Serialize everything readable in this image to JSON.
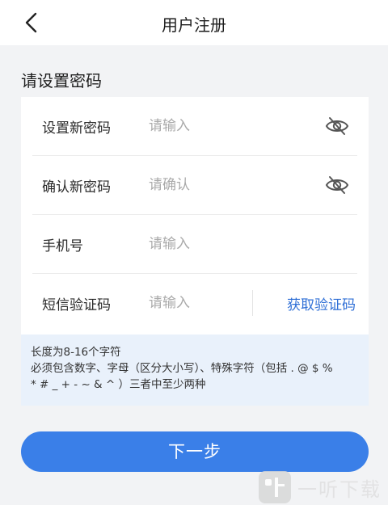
{
  "header": {
    "title": "用户注册",
    "back_icon": "chevron-left-icon"
  },
  "section_title": "请设置密码",
  "form": {
    "new_password": {
      "label": "设置新密码",
      "placeholder": "请输入",
      "icon": "eye-off-icon"
    },
    "confirm_password": {
      "label": "确认新密码",
      "placeholder": "请确认",
      "icon": "eye-off-icon"
    },
    "phone": {
      "label": "手机号",
      "placeholder": "请输入"
    },
    "sms_code": {
      "label": "短信验证码",
      "placeholder": "请输入",
      "button": "获取验证码"
    }
  },
  "hint": {
    "line1": "长度为8-16个字符",
    "line2": "必须包含数字、字母（区分大小写）、特殊字符（包括 . @ $ %",
    "line3": "* # _ + - ~ & ^ ）三者中至少两种"
  },
  "next_button": "下一步",
  "watermark": {
    "text": "一听下载",
    "icon": "listen-logo-icon"
  },
  "colors": {
    "accent": "#3a7fe8",
    "link": "#2f6fd6",
    "background": "#f2f3f5",
    "hint_bg": "#e9f1fb"
  }
}
